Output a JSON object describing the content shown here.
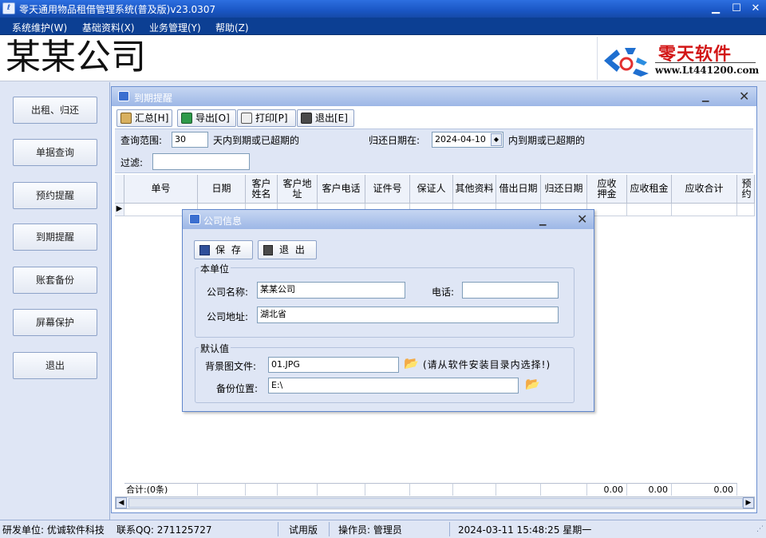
{
  "app": {
    "title": "零天通用物品租借管理系统(普及版)v23.0307",
    "window_controls": {
      "minimize": "▁",
      "maximize": "☐",
      "close": "✕"
    }
  },
  "menu": [
    "系统维护(W)",
    "基础资料(X)",
    "业务管理(Y)",
    "帮助(Z)"
  ],
  "header": {
    "company_name": "某某公司",
    "logo_text": "零天软件",
    "logo_url": "www.Lt441200.com"
  },
  "sidebar": {
    "items": [
      "出租、归还",
      "单据查询",
      "预约提醒",
      "到期提醒",
      "账套备份",
      "屏幕保护",
      "退出"
    ]
  },
  "child_window": {
    "title": "到期提醒",
    "toolbar": [
      "汇总[H]",
      "导出[O]",
      "打印[P]",
      "退出[E]"
    ],
    "query_label": "查询范围:",
    "query_days": "30",
    "query_suffix": "天内到期或已超期的",
    "return_date_label": "归还日期在:",
    "return_date": "2024-04-10",
    "return_date_suffix": "内到期或已超期的",
    "filter_label": "过滤:",
    "filter_value": "",
    "columns": [
      "单号",
      "日期",
      "客户姓名",
      "客户地址",
      "客户电话",
      "证件号",
      "保证人",
      "其他资料",
      "借出日期",
      "归还日期",
      "应收押金",
      "应收租金",
      "应收合计",
      "预约"
    ],
    "footer": {
      "count_label": "合计:(0条)",
      "deposit_total": "0.00",
      "rent_total": "0.00",
      "sum_total": "0.00"
    }
  },
  "dialog": {
    "title": "公司信息",
    "save_label": "保 存",
    "exit_label": "退 出",
    "group_unit": "本单位",
    "company_name_label": "公司名称:",
    "company_name_value": "某某公司",
    "phone_label": "电话:",
    "phone_value": "",
    "address_label": "公司地址:",
    "address_value": "湖北省",
    "group_default": "默认值",
    "bg_file_label": "背景图文件:",
    "bg_file_value": "01.JPG",
    "bg_file_hint": "(请从软件安装目录内选择!)",
    "backup_label": "备份位置:",
    "backup_value": "E:\\"
  },
  "status_bar": {
    "developer": "研发单位: 优诚软件科技",
    "qq": "联系QQ: 271125727",
    "edition": "试用版",
    "operator": "操作员: 管理员",
    "datetime": "2024-03-11 15:48:25 星期一"
  },
  "colors": {
    "titlebar": "#1a56c4",
    "menubar": "#0c3f93",
    "panel": "#dfe6f5",
    "logo_red": "#d21616"
  }
}
